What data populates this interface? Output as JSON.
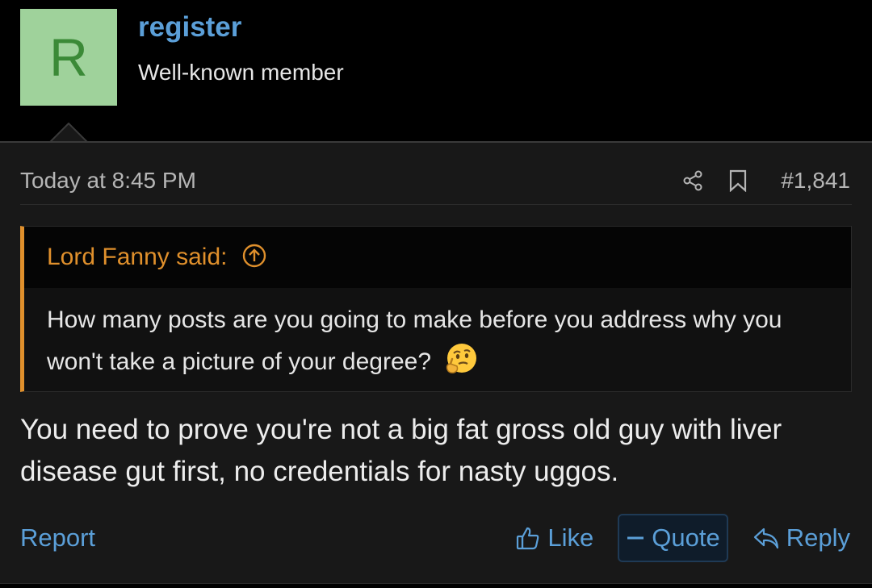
{
  "user": {
    "avatar_letter": "R",
    "name": "register",
    "title": "Well-known member"
  },
  "post": {
    "timestamp": "Today at 8:45 PM",
    "number": "#1,841",
    "quote": {
      "author_label": "Lord Fanny said:",
      "text": "How many posts are you going to make before you address why you won't take a picture of your degree?"
    },
    "body": "You need to prove you're not a big fat gross old guy with liver disease gut first, no credentials for nasty uggos."
  },
  "footer": {
    "report_label": "Report",
    "like_label": "Like",
    "quote_label": "Quote",
    "reply_label": "Reply"
  },
  "icons": {
    "share": "share-icon",
    "bookmark": "bookmark-icon",
    "quote_up": "arrow-up-circle-icon",
    "like": "thumbs-up-icon",
    "quote": "minus-icon",
    "reply": "reply-icon",
    "emoji": "thinking-face-icon"
  },
  "colors": {
    "link": "#5b9fd8",
    "quote_accent": "#e0902c",
    "avatar_bg": "#9fd29b",
    "avatar_fg": "#3b8a37",
    "post_bg": "#181818"
  }
}
